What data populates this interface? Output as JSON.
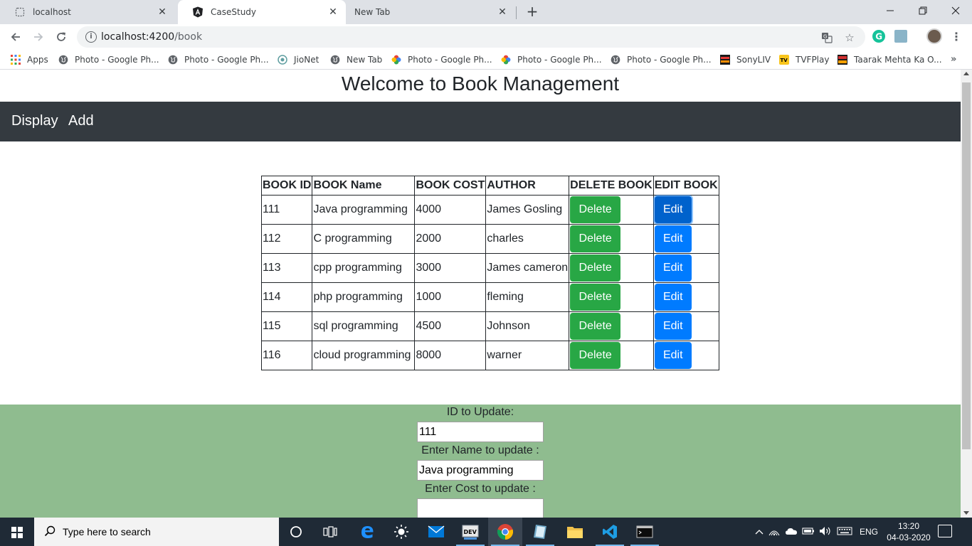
{
  "browser": {
    "tabs": [
      {
        "title": "localhost",
        "icon": "page-icon",
        "active": false
      },
      {
        "title": "CaseStudy",
        "icon": "angular-icon",
        "active": true
      },
      {
        "title": "New Tab",
        "icon": "",
        "active": false
      }
    ],
    "url_host": "localhost:4200",
    "url_path": "/book",
    "bookmarks": [
      {
        "label": "Apps",
        "icon": "apps-grid-icon"
      },
      {
        "label": "Photo - Google Ph...",
        "icon": "globe-icon"
      },
      {
        "label": "Photo - Google Ph...",
        "icon": "globe-icon"
      },
      {
        "label": "JioNet",
        "icon": "jionet-icon"
      },
      {
        "label": "New Tab",
        "icon": "globe-icon"
      },
      {
        "label": "Photo - Google Ph...",
        "icon": "google-photos-icon"
      },
      {
        "label": "Photo - Google Ph...",
        "icon": "google-photos-icon"
      },
      {
        "label": "Photo - Google Ph...",
        "icon": "globe-icon"
      },
      {
        "label": "SonyLIV",
        "icon": "sonyliv-icon"
      },
      {
        "label": "TVFPlay",
        "icon": "tvfplay-icon"
      },
      {
        "label": "Taarak Mehta Ka O...",
        "icon": "taarak-mehta-icon"
      }
    ]
  },
  "app": {
    "heading": "Welcome to Book Management",
    "nav": {
      "display": "Display",
      "add": "Add"
    },
    "table": {
      "headers": [
        "BOOK ID",
        "BOOK Name",
        "BOOK COST",
        "AUTHOR",
        "DELETE BOOK",
        "EDIT BOOK"
      ],
      "rows": [
        {
          "id": "111",
          "name": "Java programming",
          "cost": "4000",
          "author": "James Gosling"
        },
        {
          "id": "112",
          "name": "C programming",
          "cost": "2000",
          "author": "charles"
        },
        {
          "id": "113",
          "name": "cpp programming",
          "cost": "3000",
          "author": "James cameron"
        },
        {
          "id": "114",
          "name": "php programming",
          "cost": "1000",
          "author": "fleming"
        },
        {
          "id": "115",
          "name": "sql programming",
          "cost": "4500",
          "author": "Johnson"
        },
        {
          "id": "116",
          "name": "cloud programming",
          "cost": "8000",
          "author": "warner"
        }
      ],
      "delete_label": "Delete",
      "edit_label": "Edit"
    },
    "update_form": {
      "id_label": "ID to Update:",
      "id_value": "111",
      "name_label": "Enter Name to update :",
      "name_value": "Java programming",
      "cost_label": "Enter Cost to update :",
      "cost_value": ""
    }
  },
  "taskbar": {
    "search_placeholder": "Type here to search",
    "language": "ENG",
    "time": "13:20",
    "date": "04-03-2020"
  },
  "colors": {
    "navbar": "#343a40",
    "delete_button": "#28a745",
    "edit_button": "#007bff",
    "form_background": "#8fbc8f"
  }
}
